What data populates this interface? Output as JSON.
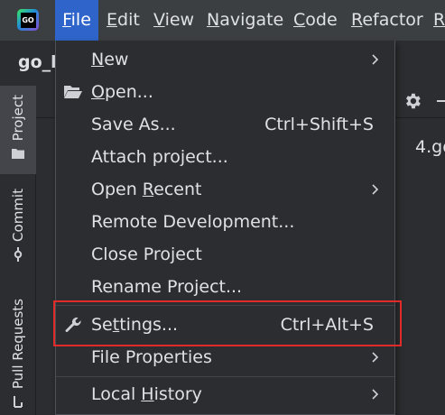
{
  "menubar": {
    "logo_text": "GO",
    "items": [
      {
        "mn": "F",
        "rest": "ile"
      },
      {
        "mn": "E",
        "rest": "dit"
      },
      {
        "mn": "V",
        "rest": "iew"
      },
      {
        "mn": "N",
        "rest": "avigate"
      },
      {
        "mn": "C",
        "rest": "ode"
      },
      {
        "mn": "R",
        "rest": "efactor"
      },
      {
        "mn": "R",
        "rest": ""
      }
    ]
  },
  "project": {
    "name_partial": "go_l",
    "file_partial": "4.go"
  },
  "sidebar": {
    "project_label": "Project",
    "commit_label": "Commit",
    "pull_requests_label": "Pull Requests"
  },
  "file_menu": {
    "new": {
      "mn": "N",
      "rest": "ew"
    },
    "open": {
      "mn": "O",
      "rest": "pen..."
    },
    "save_as": {
      "label": "Save As...",
      "shortcut": "Ctrl+Shift+S"
    },
    "attach_project": {
      "label": "Attach project..."
    },
    "open_recent": {
      "pre": "Open ",
      "mn": "R",
      "rest": "ecent"
    },
    "remote_development": {
      "label": "Remote Development..."
    },
    "close_project": {
      "label": "Close Project"
    },
    "rename_project": {
      "label": "Rename Project..."
    },
    "settings": {
      "pre": "Se",
      "mn": "t",
      "rest": "tings...",
      "shortcut": "Ctrl+Alt+S"
    },
    "file_properties": {
      "label": "File Properties"
    },
    "local_history": {
      "pre": "Local ",
      "mn": "H",
      "rest": "istory"
    }
  },
  "colors": {
    "menubar_bg": "#3c3f41",
    "active_menu": "#2f65ca",
    "popup_bg": "#2b2d30",
    "highlight_box": "#e02b2b"
  }
}
